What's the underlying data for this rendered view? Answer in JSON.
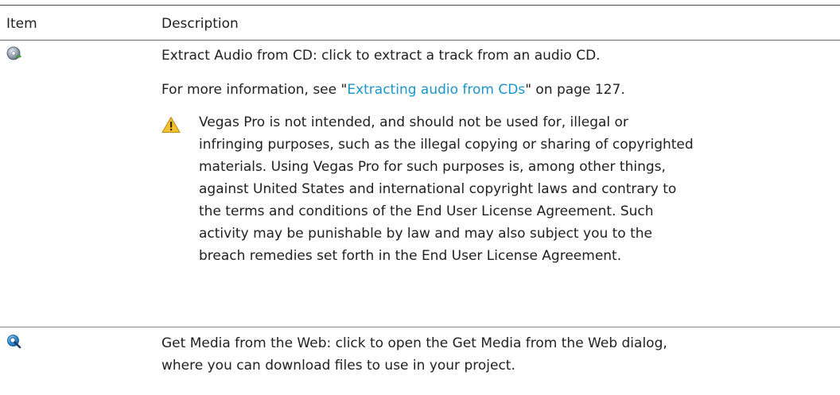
{
  "header": {
    "item": "Item",
    "description": "Description"
  },
  "row1": {
    "icon": "cd-extract-icon",
    "title": "Extract Audio from CD",
    "title_suffix": ": click to extract a track from an audio CD.",
    "more_prefix": "For more information, see \"",
    "more_link": "Extracting audio from CDs",
    "more_suffix": "\" on page 127.",
    "warning_icon": "warning-icon",
    "warning_lines": [
      "Vegas Pro is not intended, and should not be used for, illegal or",
      "infringing purposes, such as the illegal copying or sharing of copyrighted",
      "materials. Using Vegas Pro for such purposes is, among other things,",
      "against United States and international copyright laws and contrary to",
      "the terms and conditions of the End User License Agreement. Such",
      "activity may be punishable by law and may also subject you to the",
      "breach remedies set forth in the End User License Agreement."
    ]
  },
  "row2": {
    "icon": "web-search-icon",
    "title": "Get Media from the Web",
    "title_suffix": ": click to open the Get Media from the Web dialog,",
    "line2": "where you can download files to use in your project."
  }
}
